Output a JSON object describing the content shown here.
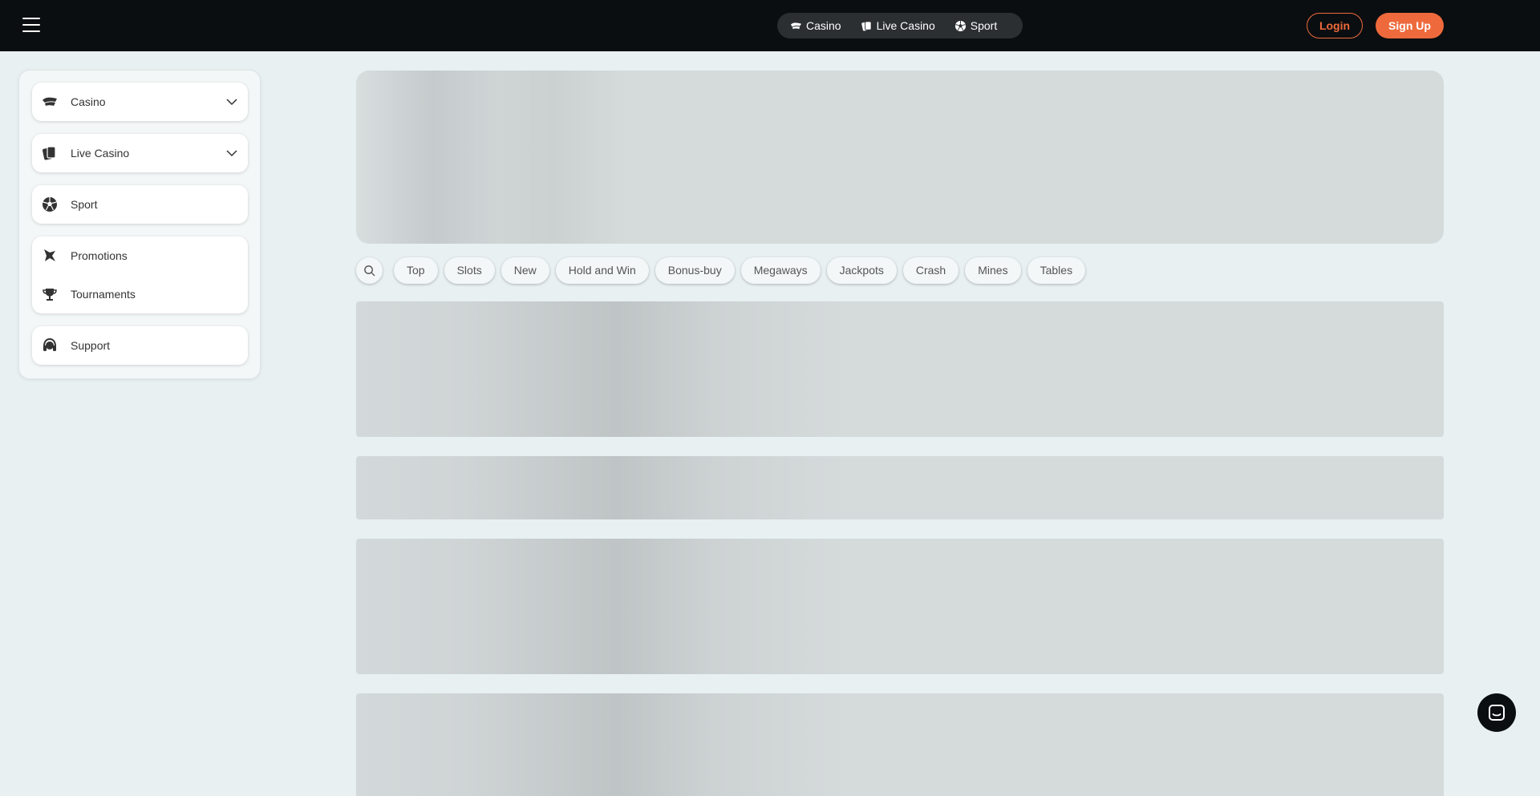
{
  "header": {
    "nav": [
      {
        "label": "Casino",
        "icon": "casino-icon"
      },
      {
        "label": "Live Casino",
        "icon": "cards-icon"
      },
      {
        "label": "Sport",
        "icon": "soccer-ball-icon"
      }
    ],
    "login_label": "Login",
    "signup_label": "Sign Up"
  },
  "sidebar": {
    "items": [
      {
        "label": "Casino",
        "icon": "casino-icon",
        "expandable": true
      },
      {
        "label": "Live Casino",
        "icon": "cards-icon",
        "expandable": true
      },
      {
        "label": "Sport",
        "icon": "soccer-ball-icon"
      },
      {
        "label": "Promotions",
        "icon": "star-badge-icon"
      },
      {
        "label": "Tournaments",
        "icon": "trophy-icon"
      },
      {
        "label": "Support",
        "icon": "headset-icon"
      }
    ]
  },
  "filters": {
    "chips": [
      "Top",
      "Slots",
      "New",
      "Hold and Win",
      "Bonus-buy",
      "Megaways",
      "Jackpots",
      "Crash",
      "Mines",
      "Tables"
    ]
  },
  "colors": {
    "accent": "#ee6a3c",
    "header_bg": "#0a0e10",
    "page_bg": "#e8f0f1"
  }
}
